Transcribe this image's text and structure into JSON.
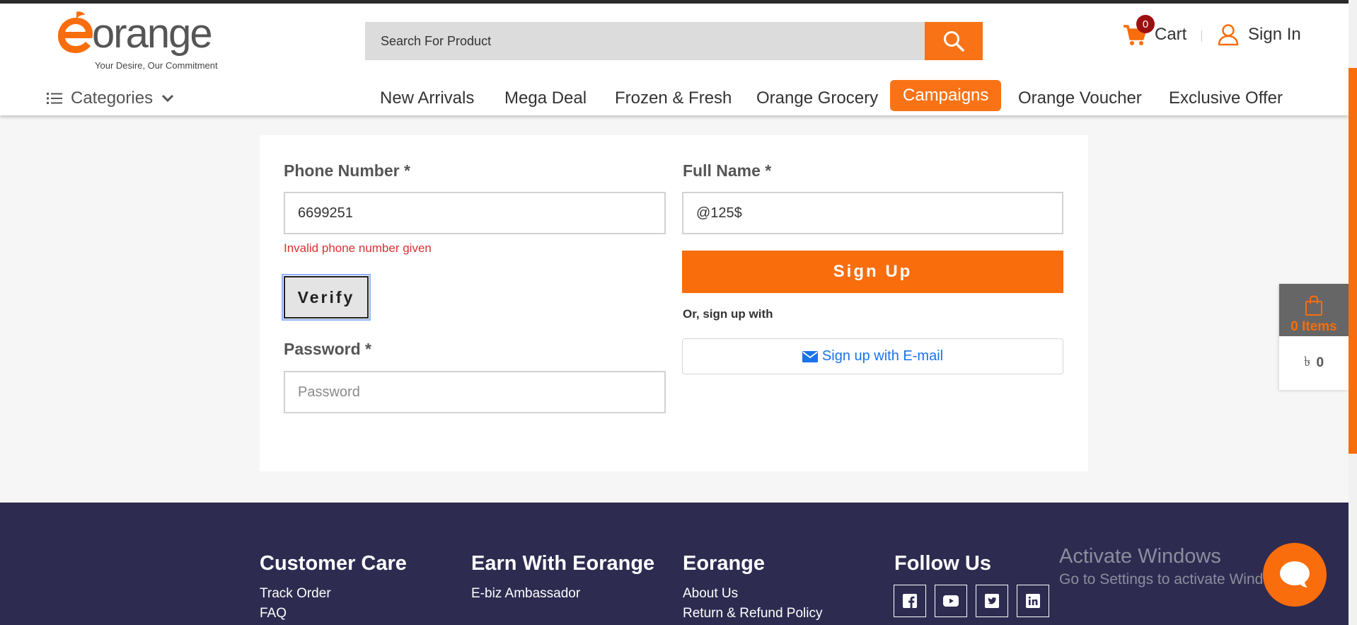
{
  "brand": {
    "logo_text": "orange",
    "tagline": "Your Desire, Our Commitment",
    "accent_color": "#f96d0c"
  },
  "header": {
    "search_placeholder": "Search For Product",
    "cart_count": "0",
    "cart_label": "Cart",
    "signin_label": "Sign In"
  },
  "nav": {
    "categories_label": "Categories",
    "items": [
      {
        "label": "New Arrivals"
      },
      {
        "label": "Mega Deal"
      },
      {
        "label": "Frozen & Fresh"
      },
      {
        "label": "Orange Grocery"
      },
      {
        "label": "Campaigns",
        "active": true
      },
      {
        "label": "Orange Voucher"
      },
      {
        "label": "Exclusive Offer"
      }
    ]
  },
  "form": {
    "phone_label": "Phone Number *",
    "phone_value": "6699251",
    "phone_error": "Invalid phone number given",
    "verify_label": "Verify",
    "password_label": "Password *",
    "password_placeholder": "Password",
    "fullname_label": "Full Name *",
    "fullname_value": "@125$",
    "signup_label": "Sign Up",
    "or_text": "Or, sign up with",
    "email_signup_label": "Sign up with E-mail"
  },
  "side_cart": {
    "items_label": "0 Items",
    "currency_symbol": "৳",
    "total": "0"
  },
  "footer": {
    "columns": [
      {
        "title": "Customer Care",
        "links": [
          "Track Order",
          "FAQ"
        ]
      },
      {
        "title": "Earn With Eorange",
        "links": [
          "E-biz Ambassador"
        ]
      },
      {
        "title": "Eorange",
        "links": [
          "About Us",
          "Return & Refund Policy"
        ]
      },
      {
        "title": "Follow Us",
        "links": []
      }
    ],
    "social_icons": [
      "facebook-icon",
      "youtube-icon",
      "twitter-icon",
      "linkedin-icon"
    ]
  },
  "os_overlay": {
    "activate_title": "Activate Windows",
    "activate_sub": "Go to Settings to activate Windows."
  }
}
